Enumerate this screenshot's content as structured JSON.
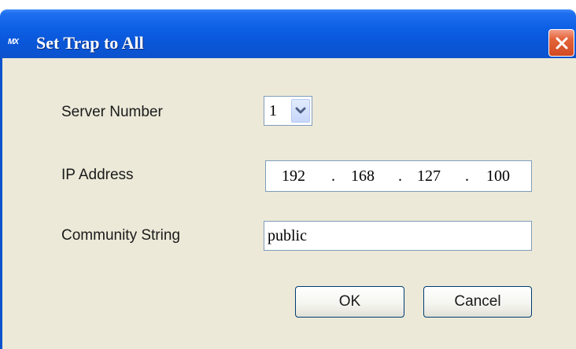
{
  "window": {
    "title": "Set Trap to All",
    "app_icon_text": "MX",
    "close_icon": "close-icon",
    "colors": {
      "titlebar": "#0c5fe4",
      "client_background": "#ece9d8",
      "close_button": "#d14a22"
    }
  },
  "form": {
    "server_number": {
      "label": "Server Number",
      "selected_value": "1",
      "arrow_icon": "chevron-down-icon"
    },
    "ip_address": {
      "label": "IP Address",
      "octets": [
        "192",
        "168",
        "127",
        "100"
      ],
      "separator": "."
    },
    "community_string": {
      "label": "Community String",
      "value": "public"
    }
  },
  "buttons": {
    "ok_label": "OK",
    "cancel_label": "Cancel"
  }
}
